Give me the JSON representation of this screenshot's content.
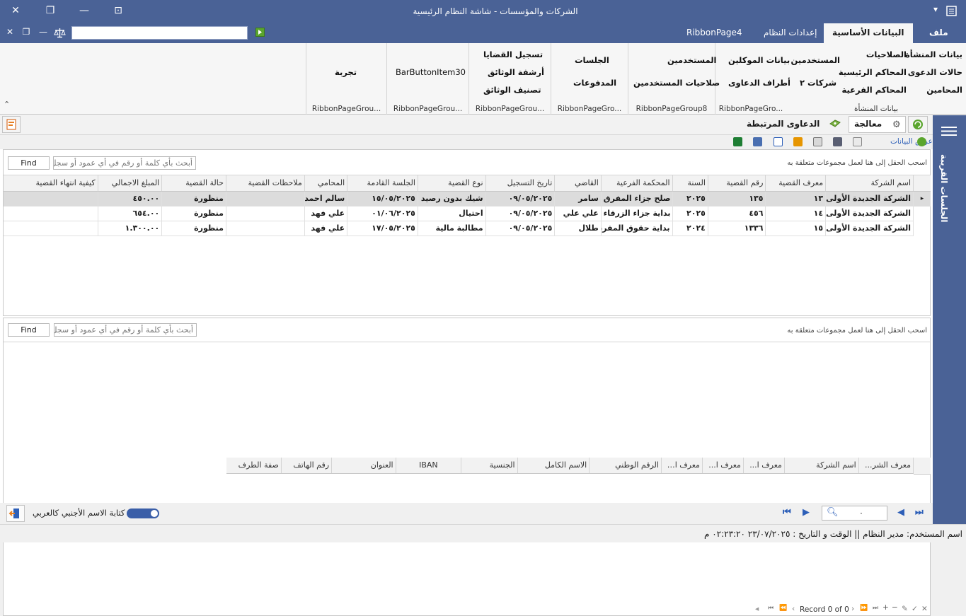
{
  "window": {
    "title": "الشركات والمؤسسات - شاشة النظام الرئيسية",
    "close": "✕",
    "restore": "❐",
    "minimize": "—",
    "dock": "⊡",
    "quickaccess_arrow": "▾"
  },
  "menu": {
    "file_tab": "ملف",
    "tabs": [
      "البيانات الأساسية",
      "إعدادات النظام",
      "RibbonPage4"
    ],
    "search_placeholder": ""
  },
  "ribbon": {
    "group1": {
      "items": [
        "بيانات المنشأة",
        "حالات الدعوى",
        "المحامين",
        "الصلاحيات",
        "المحاكم الرئيسية",
        "المحاكم الفرعية",
        "المستخدمين",
        "شركات ٢"
      ],
      "caption": "بيانات المنشأة"
    },
    "group2": {
      "items": [
        "بيانات الموكلين",
        "أطراف الدعاوى"
      ],
      "caption": "RibbonPageGro..."
    },
    "group3": {
      "items": [
        "المستخدمين",
        "صلاحيات المستخدمين"
      ],
      "caption": "RibbonPageGroup8"
    },
    "group4": {
      "items": [
        "الجلسات",
        "المدفوعات"
      ],
      "caption": "RibbonPageGro..."
    },
    "group5": {
      "items": [
        "تسجيل القضايا",
        "أرشفة الوثائق",
        "تصنيف الوثائق"
      ],
      "caption": "RibbonPageGrou..."
    },
    "group6": {
      "items": [
        "BarButtonItem30"
      ],
      "caption": "RibbonPageGrou..."
    },
    "group7": {
      "items": [
        "تجربة"
      ],
      "caption": "RibbonPageGrou..."
    }
  },
  "content_tabs": {
    "process": "معالجة",
    "related": "الدعاوى المرتبطة",
    "view_data": "عرض البيانات"
  },
  "grid1": {
    "group_hint": "اسحب الحقل إلى هنا لعمل مجموعات متعلقة به",
    "search_placeholder": "أبحث بأي كلمة أو رقم في أي عمود أو سجل",
    "find": "Find",
    "columns": [
      "اسم الشركة",
      "معرف القضية",
      "رقم القضية",
      "السنة",
      "المحكمة الفرعية",
      "القاضي",
      "تاريخ التسجيل",
      "نوع القضية",
      "الجلسة القادمة",
      "المحامي",
      "ملاحظات القضية",
      "حالة القضية",
      "المبلغ الاجمالي",
      "كيفية انتهاء القضية"
    ],
    "rows": [
      [
        "الشركة الجديدة الأولى",
        "١٣",
        "١٣٥",
        "٢٠٢٥",
        "صلح جزاء المفرق",
        "سامر",
        "٠٩/٠٥/٢٠٢٥",
        "شيك بدون رصيد",
        "١٥/٠٥/٢٠٢٥",
        "سالم احمد",
        "",
        "منظورة",
        "٤٥٠.٠٠",
        ""
      ],
      [
        "الشركة الجديدة الأولى",
        "١٤",
        "٤٥٦",
        "٢٠٢٥",
        "بداية جزاء الزرقاء",
        "علي علي",
        "٠٩/٠٥/٢٠٢٥",
        "احتيال",
        "٠١/٠٦/٢٠٢٥",
        "علي فهد",
        "",
        "منظورة",
        "٦٥٤.٠٠",
        ""
      ],
      [
        "الشركة الجديدة الأولى",
        "١٥",
        "١٣٣٦",
        "٢٠٢٤",
        "بداية حقوق المفرق",
        "طلال",
        "٠٩/٠٥/٢٠٢٥",
        "مطالبة مالية",
        "١٧/٠٥/٢٠٢٥",
        "علي فهد",
        "",
        "منظورة",
        "١.٣٠٠.٠٠",
        ""
      ]
    ],
    "row_indicator": "▸"
  },
  "grid2": {
    "group_hint": "اسحب الحقل إلى هنا لعمل مجموعات متعلقة به",
    "search_placeholder": "أبحث بأي كلمة أو رقم في أي عمود أو سجل",
    "find": "Find",
    "columns": [
      "معرف الشر...",
      "اسم الشركة",
      "معرف ا...",
      "معرف ا...",
      "معرف ال...",
      "الرقم الوطني",
      "الاسم الكامل",
      "الجنسية",
      "IBAN",
      "العنوان",
      "رقم الهاتف",
      "صفة الطرف"
    ]
  },
  "navigator": {
    "record_text": "Record 0 of 0"
  },
  "bottombar": {
    "toggle_label": "كتابة الاسم الأجنبي كالعربي",
    "search_value": "٠"
  },
  "sidebar": {
    "label": "الجلسات القريبة"
  },
  "status": {
    "user_label": "اسم المستخدم:",
    "user_value": "مدير النظام",
    "sep": "||",
    "datetime_label": "الوقت و التاريخ :",
    "datetime_value": "٢٣/٠٧/٢٠٢٥ ٠٢:٢٣:٢٠ م"
  },
  "colors": {
    "titlebar": "#4a6296",
    "accent": "#2d5fb8",
    "toggle": "#3a5ea8"
  }
}
